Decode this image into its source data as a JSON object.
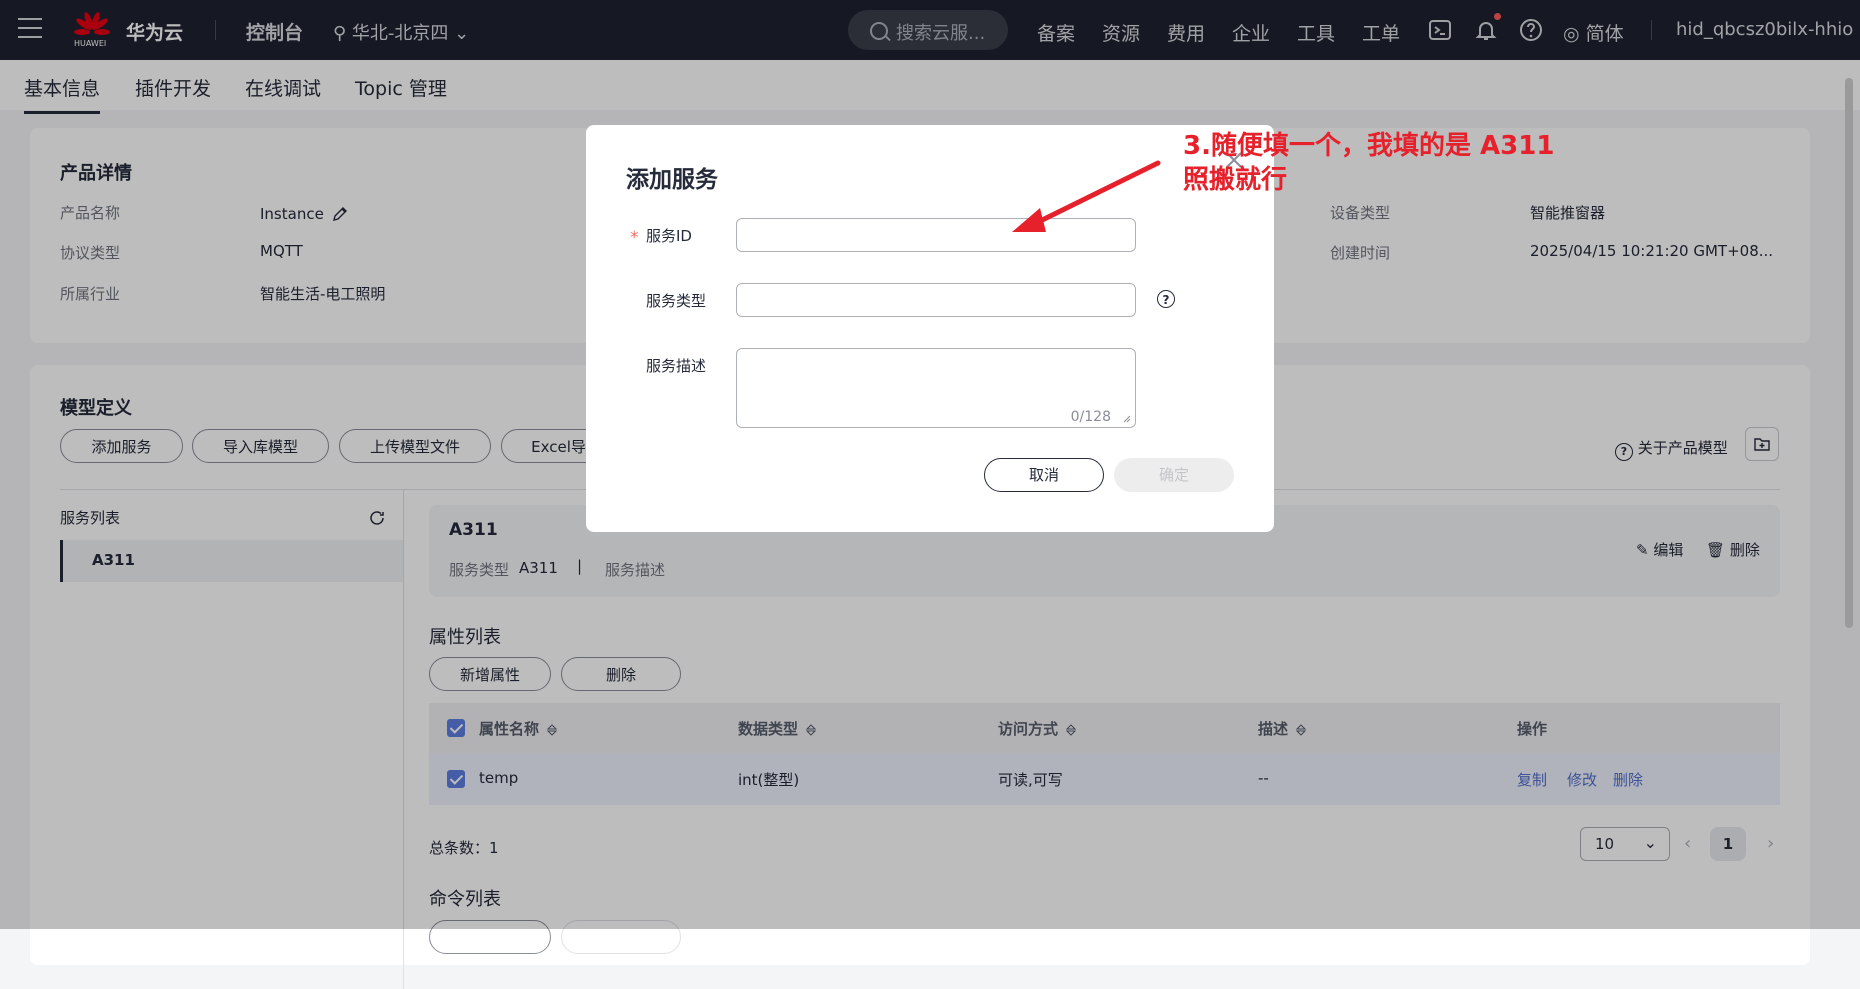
{
  "topbar": {
    "brand": "华为云",
    "logo_text": "HUAWEI",
    "console": "控制台",
    "region": "华北-北京四",
    "search_placeholder": "搜索云服...",
    "nav": [
      "备案",
      "资源",
      "费用",
      "企业",
      "工具",
      "工单"
    ],
    "language": "简体",
    "username": "hid_qbcsz0bilx-hhio"
  },
  "tabs": [
    "基本信息",
    "插件开发",
    "在线调试",
    "Topic 管理"
  ],
  "product": {
    "title": "产品详情",
    "name_label": "产品名称",
    "name_value": "Instance",
    "protocol_label": "协议类型",
    "protocol_value": "MQTT",
    "industry_label": "所属行业",
    "industry_value": "智能生活-电工照明",
    "device_type_label": "设备类型",
    "device_type_value": "智能推窗器",
    "created_label": "创建时间",
    "created_value": "2025/04/15 10:21:20 GMT+08..."
  },
  "model": {
    "title": "模型定义",
    "buttons": [
      "添加服务",
      "导入库模型",
      "上传模型文件",
      "Excel导入"
    ],
    "about": "关于产品模型",
    "service_list_title": "服务列表",
    "service_item": "A311",
    "detail_name": "A311",
    "service_type_label": "服务类型",
    "service_type_value": "A311",
    "service_desc_label": "服务描述",
    "edit": "编辑",
    "delete": "删除",
    "prop_list_title": "属性列表",
    "prop_buttons": [
      "新增属性",
      "删除"
    ],
    "columns": [
      "属性名称",
      "数据类型",
      "访问方式",
      "描述",
      "操作"
    ],
    "row": {
      "name": "temp",
      "type": "int(整型)",
      "access": "可读,可写",
      "desc": "--"
    },
    "row_actions": [
      "复制",
      "修改",
      "删除"
    ],
    "total": "总条数：1",
    "page_size": "10",
    "page": "1",
    "cmd_list_title": "命令列表"
  },
  "dialog": {
    "title": "添加服务",
    "service_id_label": "服务ID",
    "required_mark": "*",
    "service_type_label": "服务类型",
    "service_desc_label": "服务描述",
    "counter": "0/128",
    "cancel": "取消",
    "ok": "确定"
  },
  "annotation": {
    "line1": "3.随便填一个，我填的是 A311",
    "line2": "照搬就行",
    "color": "#e6212b"
  }
}
